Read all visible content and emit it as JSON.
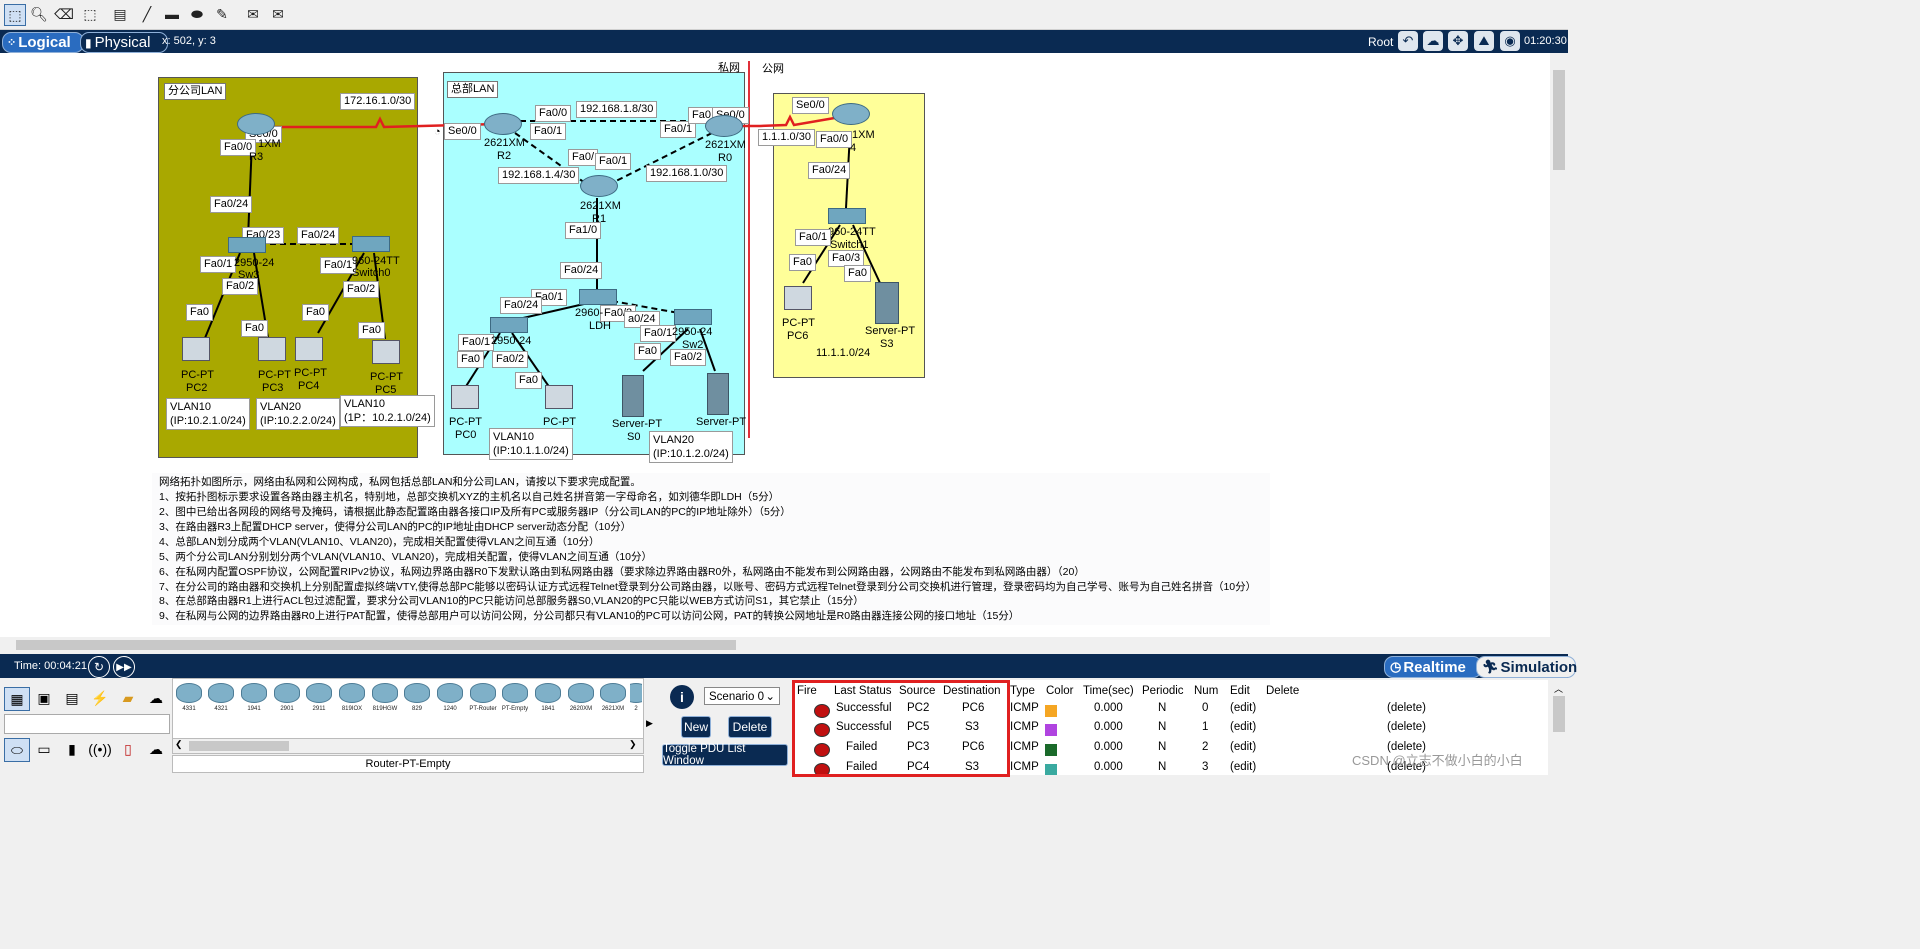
{
  "toolbar": {
    "icons": [
      "select-icon",
      "zoom-icon",
      "delete-icon",
      "resize-icon",
      "note-icon",
      "line-icon",
      "rectangle-icon",
      "ellipse-icon",
      "freeform-icon",
      "simple-pdu-icon",
      "complex-pdu-icon"
    ]
  },
  "modebar": {
    "logical_label": "Logical",
    "physical_label": "Physical",
    "coords": "x: 502, y: 3",
    "root_label": "Root",
    "clock": "01:20:30"
  },
  "zones": {
    "private": "私网",
    "public": "公网",
    "branch": "分公司LAN",
    "hq": "总部LAN"
  },
  "links": {
    "r3_r2_net": "172.16.1.0/30",
    "r2_r0_net": "192.168.1.8/30",
    "r2_r1_net": "192.168.1.4/30",
    "r0_r1_net": "192.168.1.0/30",
    "r0_isp_net": "1.1.1.0/30",
    "isp_lan_net": "11.1.1.0/24"
  },
  "ports": {
    "r3_se": "Se0/0",
    "r3_fa": "Fa0/0",
    "sw3_fa024": "Fa0/24",
    "sw3_fa023": "Fa0/23",
    "sw0_fa024": "Fa0/24",
    "sw3_fa01": "Fa0/1",
    "sw3_fa02": "Fa0/2",
    "sw0_fa01": "Fa0/1",
    "sw0_fa02": "Fa0/2",
    "pc2_fa": "Fa0",
    "pc3_fa": "Fa0",
    "pc4_fa": "Fa0",
    "pc5_fa": "Fa0",
    "r2_se": "Se0/0",
    "r2_fa00": "Fa0/0",
    "r2_fa01": "Fa0/1",
    "r1_fa00": "Fa0/",
    "r1_fa01": "Fa0/1",
    "r0_fa01": "Fa0/1",
    "r0_fa0": "Fa0",
    "r0_se": "Se0/0",
    "r1_fa10": "Fa1/0",
    "ldh_fa024": "Fa0/24",
    "ldh_fa01": "Fa0/1",
    "ldh_fa02": "Fa0/2",
    "sw2_fa024": "a0/24",
    "sw1_fa024": "Fa0/24",
    "sw1_fa01": "Fa0/1",
    "sw1_fa02": "Fa0/2",
    "pc0_fa": "Fa0",
    "pc1_fa": "Fa0",
    "sw2_fa01": "Fa0/1",
    "sw2_fa02": "Fa0/2",
    "s0_fa": "Fa0",
    "isp_se": "Se0/0",
    "isp_fa0": "Fa0/0",
    "isp_sw_fa024": "Fa0/24",
    "isp_sw_fa01": "Fa0/1",
    "isp_sw_fa03": "Fa0/3",
    "pc6_fa": "Fa0",
    "s3_fa": "Fa0"
  },
  "devices": {
    "r3_type": "1XM",
    "r3_name": "R3",
    "r2_type": "2621XM",
    "r2_name": "R2",
    "r0_type": "2621XM",
    "r0_name": "R0",
    "r1_type": "2621XM",
    "r1_name": "R1",
    "isp_type": "1XM",
    "isp_name": "4",
    "sw3_type": "2950-24",
    "sw3_name": "Sw3",
    "sw0_type": "960-24TT",
    "sw0_name": "Switch0",
    "ldh_type": "2960-",
    "ldh_name": "LDH",
    "sw1_type": "2950-24",
    "sw2_type": "2950-24",
    "sw2_name": "Sw2",
    "isp_sw_type": "960-24TT",
    "isp_sw_name": "Switch1",
    "pc2_type": "PC-PT",
    "pc2_name": "PC2",
    "pc3_type": "PC-PT",
    "pc3_name": "PC3",
    "pc4_type": "PC-PT",
    "pc4_name": "PC4",
    "pc5_type": "PC-PT",
    "pc5_name": "PC5",
    "pc0_type": "PC-PT",
    "pc0_name": "PC0",
    "pc1_type": "PC-PT",
    "s0_type": "Server-PT",
    "s0_name": "S0",
    "s1_type": "Server-PT",
    "pc6_type": "PC-PT",
    "pc6_name": "PC6",
    "s3_type": "Server-PT",
    "s3_name": "S3"
  },
  "vlans": {
    "pc2": [
      "VLAN10",
      "(IP:10.2.1.0/24)"
    ],
    "pc3": [
      "VLAN20",
      "(IP:10.2.2.0/24)"
    ],
    "pc5": [
      "VLAN10",
      "(1P：10.2.1.0/24)"
    ],
    "pc1": [
      "VLAN10",
      "(IP:10.1.1.0/24)"
    ],
    "s1": [
      "VLAN20",
      "(IP:10.1.2.0/24)"
    ]
  },
  "tasks": [
    "网络拓扑如图所示，网络由私网和公网构成，私网包括总部LAN和分公司LAN，请按以下要求完成配置。",
    "1、按拓扑图标示要求设置各路由器主机名，特别地，总部交换机XYZ的主机名以自己姓名拼音第一字母命名，如刘德华即LDH（5分）",
    "2、图中已给出各网段的网络号及掩码，请根据此静态配置路由器各接口IP及所有PC或服务器IP（分公司LAN的PC的IP地址除外）（5分）",
    "3、在路由器R3上配置DHCP server，使得分公司LAN的PC的IP地址由DHCP server动态分配（10分）",
    "4、总部LAN划分成两个VLAN(VLAN10、VLAN20)，完成相关配置使得VLAN之间互通（10分）",
    "5、两个分公司LAN分别划分两个VLAN(VLAN10、VLAN20)，完成相关配置，使得VLAN之间互通（10分）",
    "6、在私网内配置OSPF协议，公网配置RIPv2协议，私网边界路由器R0下发默认路由到私网路由器（要求除边界路由器R0外，私网路由不能发布到公网路由器，公网路由不能发布到私网路由器）（20）",
    "7、在分公司的路由器和交换机上分别配置虚拟终端VTY,使得总部PC能够以密码认证方式远程Telnet登录到分公司路由器，以账号、密码方式远程Telnet登录到分公司交换机进行管理，登录密码均为自己学号、账号为自己姓名拼音（10分）",
    "8、在总部路由器R1上进行ACL包过滤配置，要求分公司VLAN10的PC只能访问总部服务器S0,VLAN20的PC只能以WEB方式访问S1，其它禁止（15分）",
    "9、在私网与公网的边界路由器R0上进行PAT配置，使得总部用户可以访问公网，分公司都只有VLAN10的PC可以访问公网，PAT的转换公网地址是R0路由器连接公网的接口地址（15分）"
  ],
  "timebar": {
    "time": "Time: 00:04:21",
    "realtime_label": "Realtime",
    "simulation_label": "Simulation"
  },
  "device_models": [
    "4331",
    "4321",
    "1941",
    "2901",
    "2911",
    "819IOX",
    "819HGW",
    "829",
    "1240",
    "PT-Router",
    "PT-Empty",
    "1841",
    "2620XM",
    "2621XM",
    "2"
  ],
  "selected_model": "Router-PT-Empty",
  "scenario": {
    "select_value": "Scenario 0",
    "new_label": "New",
    "delete_label": "Delete",
    "toggle_label": "Toggle PDU List Window"
  },
  "pdu_table": {
    "headers": [
      "Fire",
      "Last Status",
      "Source",
      "Destination",
      "Type",
      "Color",
      "Time(sec)",
      "Periodic",
      "Num",
      "Edit",
      "Delete"
    ],
    "rows": [
      {
        "status": "Successful",
        "source": "PC2",
        "dest": "PC6",
        "type": "ICMP",
        "color": "#f5a623",
        "time": "0.000",
        "periodic": "N",
        "num": "0",
        "edit": "(edit)",
        "delete": "(delete)"
      },
      {
        "status": "Successful",
        "source": "PC5",
        "dest": "S3",
        "type": "ICMP",
        "color": "#b044e0",
        "time": "0.000",
        "periodic": "N",
        "num": "1",
        "edit": "(edit)",
        "delete": "(delete)"
      },
      {
        "status": "Failed",
        "source": "PC3",
        "dest": "PC6",
        "type": "ICMP",
        "color": "#1a6a2a",
        "time": "0.000",
        "periodic": "N",
        "num": "2",
        "edit": "(edit)",
        "delete": "(delete)"
      },
      {
        "status": "Failed",
        "source": "PC4",
        "dest": "S3",
        "type": "ICMP",
        "color": "#3aaaa0",
        "time": "0.000",
        "periodic": "N",
        "num": "3",
        "edit": "(edit)",
        "delete": "(delete)"
      }
    ]
  },
  "watermark": "CSDN @立志不做小白的小白"
}
